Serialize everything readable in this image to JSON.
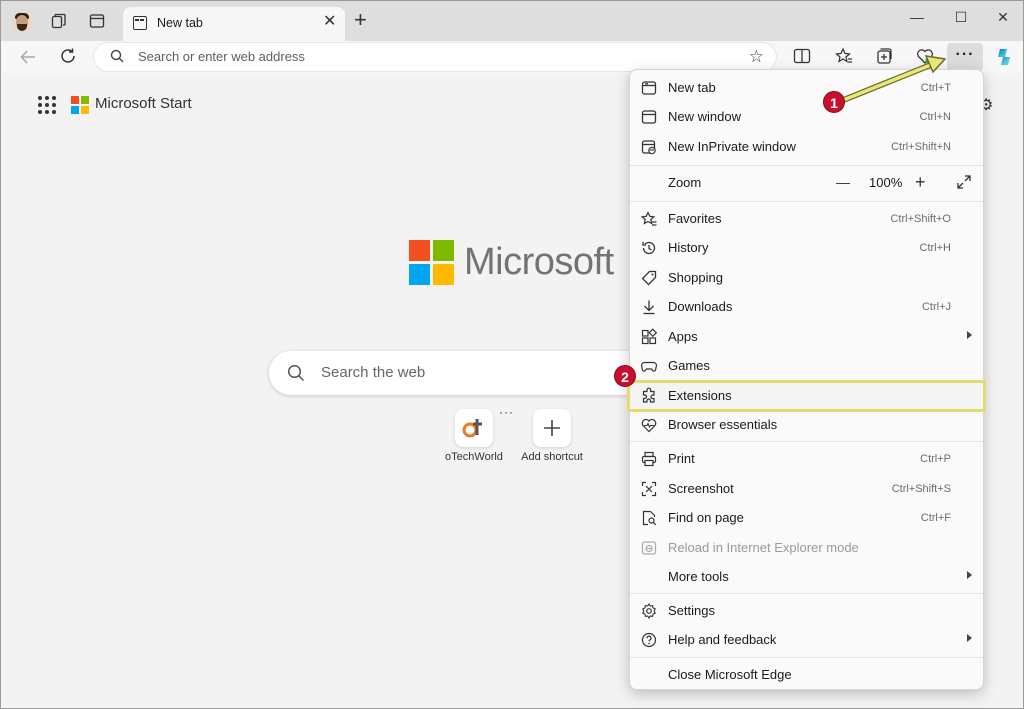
{
  "browser": {
    "tab": {
      "title": "New tab",
      "close_glyph": "✕"
    },
    "new_tab_glyph": "+",
    "window_controls": {
      "minimize": "—",
      "maximize": "☐",
      "close": "✕"
    },
    "address_placeholder": "Search or enter web address",
    "more_glyph": "···"
  },
  "page": {
    "brand": "Microsoft Start",
    "logo_word": "Microsoft",
    "search_placeholder": "Search the web",
    "shortcuts": [
      {
        "label": "oTechWorld"
      },
      {
        "label": "Add shortcut"
      }
    ],
    "shortcut_more": "···"
  },
  "menu": {
    "items": [
      {
        "label": "New tab",
        "shortcut": "Ctrl+T",
        "icon": "new-tab-icon"
      },
      {
        "label": "New window",
        "shortcut": "Ctrl+N",
        "icon": "window-icon"
      },
      {
        "label": "New InPrivate window",
        "shortcut": "Ctrl+Shift+N",
        "icon": "inprivate-icon"
      },
      {
        "label": "Favorites",
        "shortcut": "Ctrl+Shift+O",
        "icon": "favorites-icon"
      },
      {
        "label": "History",
        "shortcut": "Ctrl+H",
        "icon": "history-icon"
      },
      {
        "label": "Shopping",
        "shortcut": "",
        "icon": "tag-icon"
      },
      {
        "label": "Downloads",
        "shortcut": "Ctrl+J",
        "icon": "download-icon"
      },
      {
        "label": "Apps",
        "shortcut": "",
        "icon": "apps-icon"
      },
      {
        "label": "Games",
        "shortcut": "",
        "icon": "games-icon"
      },
      {
        "label": "Extensions",
        "shortcut": "",
        "icon": "puzzle-icon"
      },
      {
        "label": "Browser essentials",
        "shortcut": "",
        "icon": "heart-pulse-icon"
      },
      {
        "label": "Print",
        "shortcut": "Ctrl+P",
        "icon": "printer-icon"
      },
      {
        "label": "Screenshot",
        "shortcut": "Ctrl+Shift+S",
        "icon": "screenshot-icon"
      },
      {
        "label": "Find on page",
        "shortcut": "Ctrl+F",
        "icon": "find-icon"
      },
      {
        "label": "Reload in Internet Explorer mode",
        "shortcut": "",
        "icon": "ie-icon"
      },
      {
        "label": "More tools",
        "shortcut": "",
        "icon": ""
      },
      {
        "label": "Settings",
        "shortcut": "",
        "icon": "gear-icon"
      },
      {
        "label": "Help and feedback",
        "shortcut": "",
        "icon": "help-icon"
      },
      {
        "label": "Close Microsoft Edge",
        "shortcut": "",
        "icon": ""
      }
    ],
    "zoom": {
      "label": "Zoom",
      "value": "100%",
      "minus": "—",
      "plus": "+"
    }
  },
  "annotations": {
    "step1": "1",
    "step2": "2"
  },
  "colors": {
    "highlight_border": "#e1dc6b",
    "badge": "#c8102e",
    "ms_red": "#f25022",
    "ms_green": "#7fba00",
    "ms_blue": "#00a4ef",
    "ms_yellow": "#ffb900"
  }
}
